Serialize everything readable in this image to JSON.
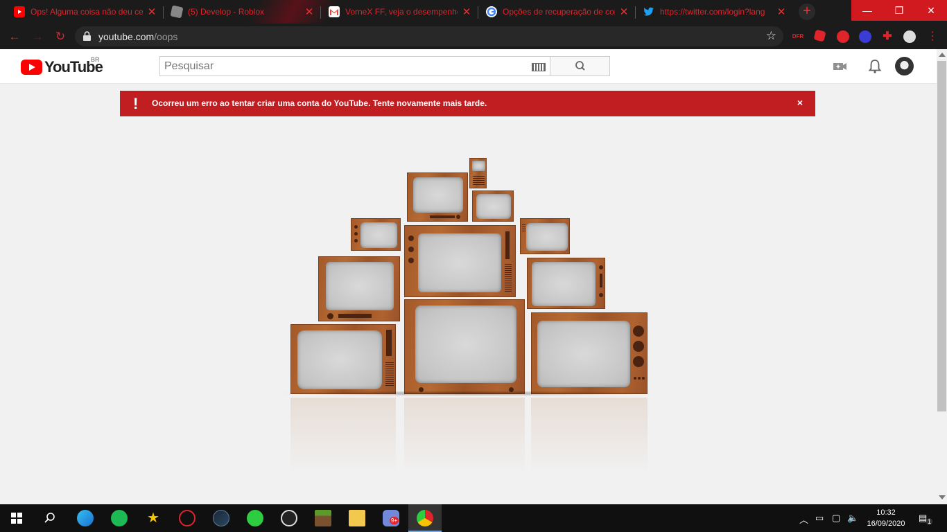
{
  "browser": {
    "tabs": [
      {
        "title": "Ops! Alguma coisa não deu certo",
        "favicon": "youtube-icon",
        "color": "#ff0000"
      },
      {
        "title": "(5) Develop - Roblox",
        "favicon": "roblox-icon",
        "color": "#888888"
      },
      {
        "title": "VorneX FF, veja o desempenho",
        "favicon": "gmail-icon",
        "color": "#ea4335"
      },
      {
        "title": "Opções de recuperação de conta",
        "favicon": "google-icon",
        "color": "#4285f4"
      },
      {
        "title": "https://twitter.com/login?lang",
        "favicon": "twitter-icon",
        "color": "#1da1f2"
      }
    ],
    "new_tab": "+",
    "url_host": "youtube.com",
    "url_path": "/oops",
    "window_controls": {
      "minimize": "—",
      "restore": "❐",
      "close": "✕"
    },
    "extensions": [
      {
        "name": "dfr-extension-icon",
        "label": "DFR"
      },
      {
        "name": "roblox-extension-icon",
        "label": ""
      },
      {
        "name": "stop-extension-icon",
        "label": ""
      },
      {
        "name": "eye-extension-icon",
        "label": ""
      },
      {
        "name": "puzzle-extension-icon",
        "label": ""
      },
      {
        "name": "profile-avatar-icon",
        "label": ""
      }
    ]
  },
  "youtube": {
    "logo_text": "YouTube",
    "country_code": "BR",
    "search_placeholder": "Pesquisar",
    "error_message": "Ocorreu um erro ao tentar criar uma conta do YouTube. Tente novamente mais tarde.",
    "error_icon": "!",
    "error_close": "×"
  },
  "taskbar": {
    "time": "10:32",
    "date": "16/09/2020",
    "notification_count": "1",
    "discord_badge": "9+"
  },
  "colors": {
    "accent_red": "#e0242b",
    "alert_red": "#c11e22",
    "youtube_red": "#ff0000"
  }
}
